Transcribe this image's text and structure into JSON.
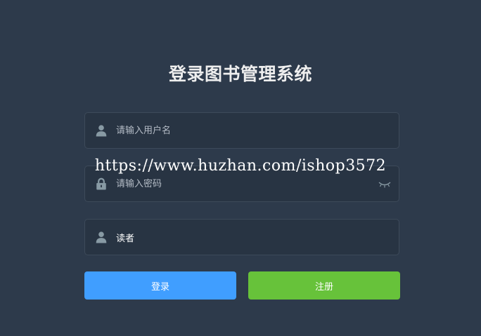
{
  "login_form": {
    "title": "登录图书管理系统",
    "username": {
      "value": "",
      "placeholder": "请输入用户名",
      "icon": "user-icon"
    },
    "password": {
      "value": "",
      "placeholder": "请输入密码",
      "icon": "lock-icon",
      "toggle_icon": "eye-closed-icon"
    },
    "role": {
      "value": "读者",
      "icon": "user-icon"
    },
    "login_button": "登录",
    "register_button": "注册"
  },
  "watermark": "https://www.huzhan.com/ishop3572",
  "colors": {
    "background": "#2d3a4b",
    "input_background": "#283443",
    "login_button": "#409eff",
    "register_button": "#67c23a"
  }
}
